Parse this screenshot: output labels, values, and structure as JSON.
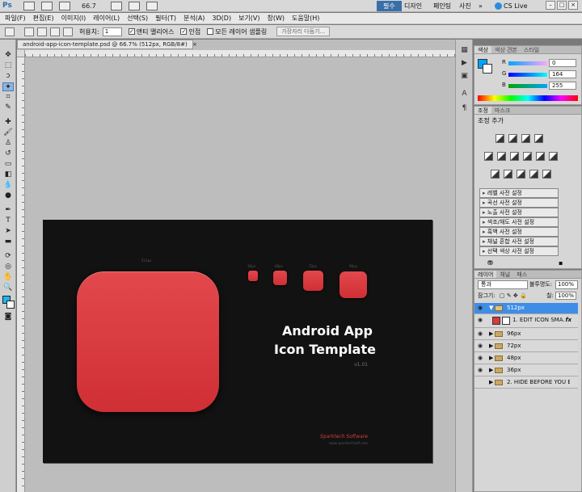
{
  "app": {
    "logo": "Ps",
    "zoom": "66.7"
  },
  "workspaces": [
    {
      "label": "필수",
      "active": true
    },
    {
      "label": "디자인",
      "active": false
    },
    {
      "label": "페인팅",
      "active": false
    },
    {
      "label": "사진",
      "active": false
    }
  ],
  "workspace_more": "»",
  "cs_live": "CS Live",
  "window_buttons": [
    "–",
    "□",
    "×"
  ],
  "menu": [
    "파일(F)",
    "편집(E)",
    "이미지(I)",
    "레이어(L)",
    "선택(S)",
    "필터(T)",
    "분석(A)",
    "3D(D)",
    "보기(V)",
    "창(W)",
    "도움말(H)"
  ],
  "options": {
    "tolerance_label": "허용치:",
    "tolerance_value": "1",
    "antialias": "앤티 앨리어스",
    "contiguous": "인접",
    "sample_all": "모든 레이어 샘플링",
    "refine_button": "가장자리 다듬기..."
  },
  "document": {
    "tab_title": "android-app-icon-template.psd @ 66.7% (512px, RGB/8#)",
    "close": "×"
  },
  "canvas": {
    "size_512": "512px",
    "size_96": "96px",
    "size_48": "48px",
    "size_72": "72px",
    "size_36": "36px",
    "title_line1": "Android App",
    "title_line2": "Icon Template",
    "version": "v1.01",
    "brand": "Sparktech Software",
    "brand_url": "www.sparktechsoft.com"
  },
  "color_panel": {
    "tabs": [
      "색상",
      "색상 견본",
      "스타일"
    ],
    "channels": [
      {
        "label": "R",
        "value": "0"
      },
      {
        "label": "G",
        "value": "164"
      },
      {
        "label": "B",
        "value": "255"
      }
    ],
    "fg_color": "#00A4FF"
  },
  "adjust_panel": {
    "tabs": [
      "조정",
      "마스크"
    ],
    "title": "조정 추가",
    "presets": [
      "레벨 사전 설정",
      "곡선 사전 설정",
      "노출 사전 설정",
      "색조/채도 사전 설정",
      "흑백 사전 설정",
      "채널 혼합 사전 설정",
      "선택 색상 사전 설정"
    ]
  },
  "layers_panel": {
    "tabs": [
      "레이어",
      "채널",
      "패스"
    ],
    "blend_mode": "통과",
    "opacity_label": "불투명도:",
    "opacity_value": "100%",
    "lock_label": "잠그기:",
    "fill_label": "칠:",
    "fill_value": "100%",
    "layers": [
      {
        "name": "512px",
        "type": "group-open",
        "selected": true
      },
      {
        "name": "1. EDIT ICON SMA...",
        "type": "smart",
        "fx": "fx"
      },
      {
        "name": "96px",
        "type": "group"
      },
      {
        "name": "72px",
        "type": "group"
      },
      {
        "name": "48px",
        "type": "group"
      },
      {
        "name": "36px",
        "type": "group"
      },
      {
        "name": "2. HIDE BEFORE YOU EX...",
        "type": "group"
      }
    ]
  }
}
